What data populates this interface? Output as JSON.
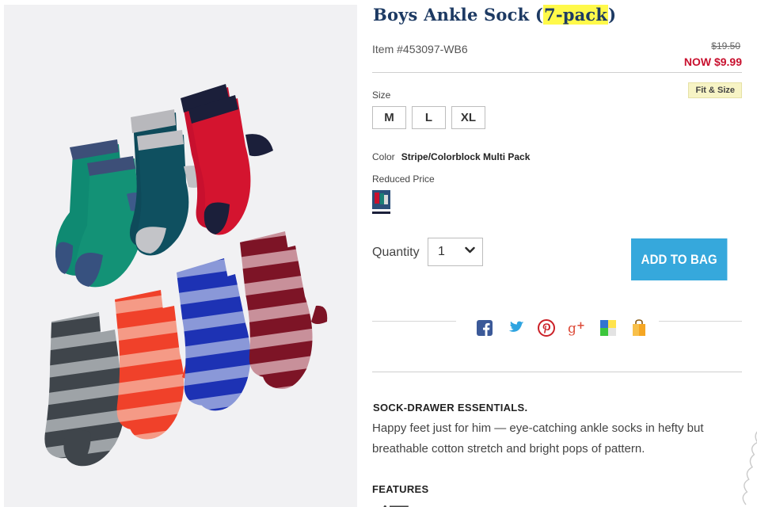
{
  "product": {
    "title_main": "Boys Ankle Sock ",
    "title_paren_open": "(",
    "title_highlight": "7-pack",
    "title_paren_close": ")",
    "item_number": "Item #453097-WB6",
    "price_original": "$19.50",
    "price_now": "NOW $9.99"
  },
  "size": {
    "label": "Size",
    "fit_link": "Fit & Size",
    "options": [
      "M",
      "L",
      "XL"
    ]
  },
  "color": {
    "label": "Color",
    "value": "Stripe/Colorblock Multi Pack",
    "reduced_label": "Reduced Price"
  },
  "quantity": {
    "label": "Quantity",
    "value": "1"
  },
  "buttons": {
    "add_to_bag": "ADD TO BAG"
  },
  "share": {
    "icons": [
      "facebook-icon",
      "twitter-icon",
      "pinterest-icon",
      "google-plus-icon",
      "delicious-icon",
      "shopping-bag-icon"
    ]
  },
  "description": {
    "heading": "SOCK-DRAWER ESSENTIALS.",
    "body": "Happy feet just for him — eye-catching ankle socks in hefty but breathable cotton stretch and bright pops of pattern."
  },
  "features": {
    "heading": "FEATURES"
  },
  "colors": {
    "title": "#1d3a63",
    "price_now": "#c8102e",
    "button": "#36a8dc",
    "highlight": "#fff94a"
  }
}
